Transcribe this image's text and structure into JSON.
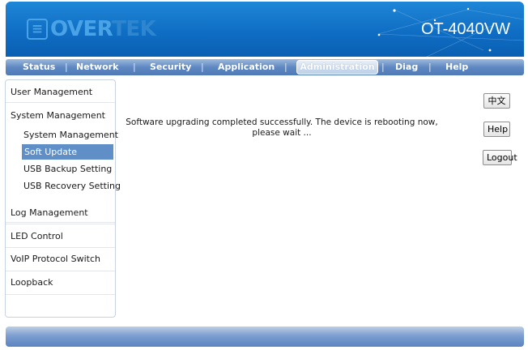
{
  "header": {
    "logo_mark": "≡",
    "logo_part1": "OVER",
    "logo_part2": "TEK",
    "model": "OT-4040VW"
  },
  "nav": {
    "items": [
      {
        "label": "Status"
      },
      {
        "label": "Network"
      },
      {
        "label": "Security"
      },
      {
        "label": "Application"
      },
      {
        "label": "Administration",
        "active": true
      },
      {
        "label": "Diag"
      },
      {
        "label": "Help"
      }
    ],
    "separator": "|"
  },
  "sidebar": {
    "groups": [
      {
        "label": "User Management"
      },
      {
        "label": "System Management",
        "children": [
          {
            "label": "System Management"
          },
          {
            "label": "Soft Update",
            "active": true
          },
          {
            "label": "USB Backup Setting"
          },
          {
            "label": "USB Recovery Setting"
          }
        ]
      },
      {
        "label": "Log Management"
      },
      {
        "label": "LED Control"
      },
      {
        "label": "VoIP Protocol Switch"
      },
      {
        "label": "Loopback"
      }
    ]
  },
  "main": {
    "message_line1": "Software upgrading completed successfully. The device is rebooting now,",
    "message_line2": "please wait ..."
  },
  "buttons": {
    "language": "中文",
    "help": "Help",
    "logout": "Logout"
  },
  "colors": {
    "header_blue": "#0f6ec4",
    "nav_blue": "#5f88c2",
    "sidebar_active": "#5f8fc6"
  }
}
